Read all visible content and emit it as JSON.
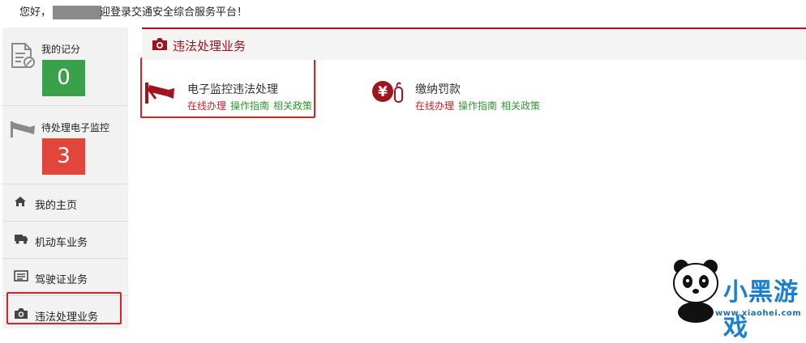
{
  "greeting": {
    "before": "您好，",
    "after": "迎登录交通安全综合服务平台！"
  },
  "sidebar": {
    "cards": [
      {
        "label": "我的记分",
        "value": "0",
        "color": "#3aa14a",
        "icon": "document-edit-icon"
      },
      {
        "label": "待处理电子监控",
        "value": "3",
        "color": "#e2463a",
        "icon": "camera-surveillance-icon"
      }
    ],
    "nav": [
      {
        "label": "我的主页",
        "icon": "home-icon"
      },
      {
        "label": "机动车业务",
        "icon": "truck-icon"
      },
      {
        "label": "驾驶证业务",
        "icon": "license-card-icon"
      },
      {
        "label": "违法处理业务",
        "icon": "camera-icon"
      }
    ]
  },
  "panel": {
    "title": "违法处理业务",
    "services": [
      {
        "name": "电子监控违法处理",
        "links": [
          "在线办理",
          "操作指南",
          "相关政策"
        ],
        "icon": "surveillance-camera-icon"
      },
      {
        "name": "缴纳罚款",
        "links": [
          "在线办理",
          "操作指南",
          "相关政策"
        ],
        "icon": "yuan-payment-icon"
      }
    ]
  },
  "watermark": {
    "brand": "小黑游戏",
    "url": "www.xiaohei.com"
  },
  "colors": {
    "accent": "#a0141e",
    "highlight_box": "#e02020",
    "link_red": "#d21d24",
    "link_green": "#2f9a2f"
  }
}
